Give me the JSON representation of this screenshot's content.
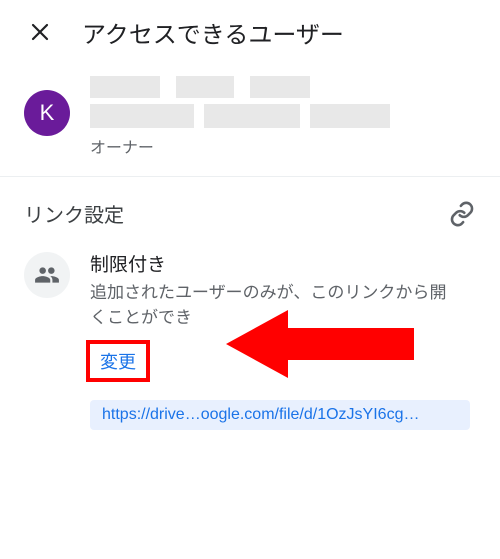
{
  "header": {
    "title": "アクセスできるユーザー"
  },
  "owner": {
    "avatar_initial": "K",
    "role": "オーナー"
  },
  "link_settings": {
    "title": "リンク設定",
    "restricted_title": "制限付き",
    "restricted_desc_prefix": "追加されたユーザーのみが、このリンクから開くことができ",
    "change_label": "変更",
    "url": "https://drive…oogle.com/file/d/1OzJsYI6cg…"
  }
}
